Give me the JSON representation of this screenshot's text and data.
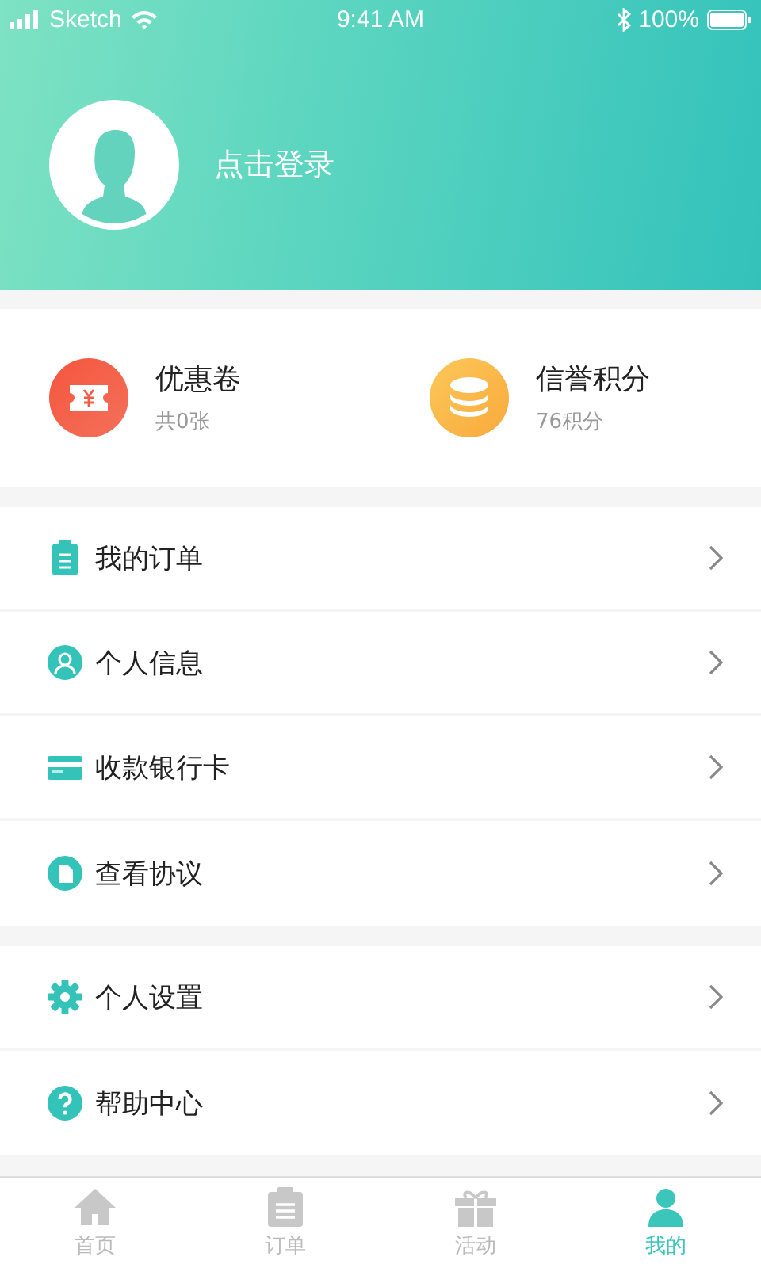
{
  "status_bar": {
    "carrier": "Sketch",
    "time": "9:41 AM",
    "battery": "100%"
  },
  "profile": {
    "login": "点击登录"
  },
  "stats": [
    {
      "kind": "coupon",
      "title": "优惠卷",
      "subtitle": "共0张"
    },
    {
      "kind": "points",
      "title": "信誉积分",
      "subtitle": "76积分"
    }
  ],
  "menu_groups": [
    [
      {
        "kind": "orders",
        "label": "我的订单"
      },
      {
        "kind": "person",
        "label": "个人信息"
      },
      {
        "kind": "card",
        "label": "收款银行卡"
      },
      {
        "kind": "document",
        "label": "查看协议"
      }
    ],
    [
      {
        "kind": "settings",
        "label": "个人设置"
      },
      {
        "kind": "help",
        "label": "帮助中心"
      }
    ]
  ],
  "tabs": [
    {
      "kind": "home",
      "label": "首页",
      "selected": false
    },
    {
      "kind": "orders",
      "label": "订单",
      "selected": false
    },
    {
      "kind": "gift",
      "label": "活动",
      "selected": false
    },
    {
      "kind": "me",
      "label": "我的",
      "selected": true
    }
  ]
}
